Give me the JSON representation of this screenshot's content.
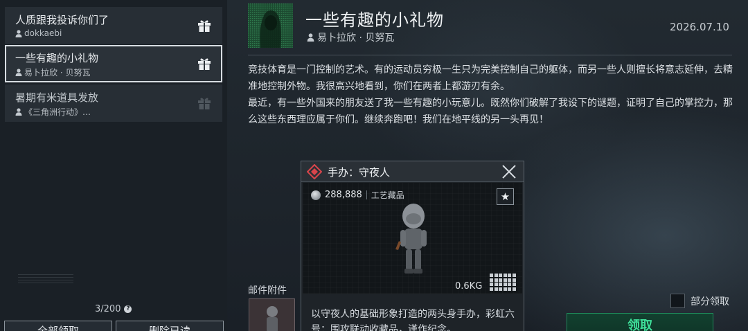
{
  "mail_list": {
    "items": [
      {
        "title": "人质跟我投诉你们了",
        "sender": "dokkaebi",
        "has_gift": true,
        "selected": false
      },
      {
        "title": "一些有趣的小礼物",
        "sender": "易卜拉欣 · 贝努瓦",
        "has_gift": true,
        "selected": true
      },
      {
        "title": "暑期有米道具发放",
        "sender": "《三角洲行动》…",
        "has_gift": true,
        "selected": false
      }
    ],
    "count": "3/200",
    "count_help": "?",
    "buttons": {
      "claim_all": "全部领取",
      "delete_read": "删除已读"
    }
  },
  "mail": {
    "title": "一些有趣的小礼物",
    "sender": "易卜拉欣 · 贝努瓦",
    "date": "2026.07.10",
    "body": [
      "竞技体育是一门控制的艺术。有的运动员穷极一生只为完美控制自己的躯体，而另一些人则擅长将意志延伸，去精准地控制外物。我很高兴地看到，你们在两者上都游刃有余。",
      "最近，有一些外国来的朋友送了我一些有趣的小玩意儿。既然你们破解了我设下的谜题，证明了自己的掌控力，那么这些东西理应属于你们。继续奔跑吧！我们在地平线的另一头再见！"
    ],
    "attachments_label": "邮件附件",
    "partial_claim_label": "部分领取",
    "claim_button": "领取"
  },
  "item_card": {
    "title": "手办：守夜人",
    "price": "288,888",
    "category": "工艺藏品",
    "weight": "0.6KG",
    "description": "以守夜人的基础形象打造的两头身手办，彩虹六号：围攻联动收藏品，谨作纪念。",
    "favorite_icon": "star-icon",
    "close_icon": "close-icon"
  },
  "colors": {
    "accent_green": "#3ee09a",
    "item_diamond": "#d9454b"
  }
}
